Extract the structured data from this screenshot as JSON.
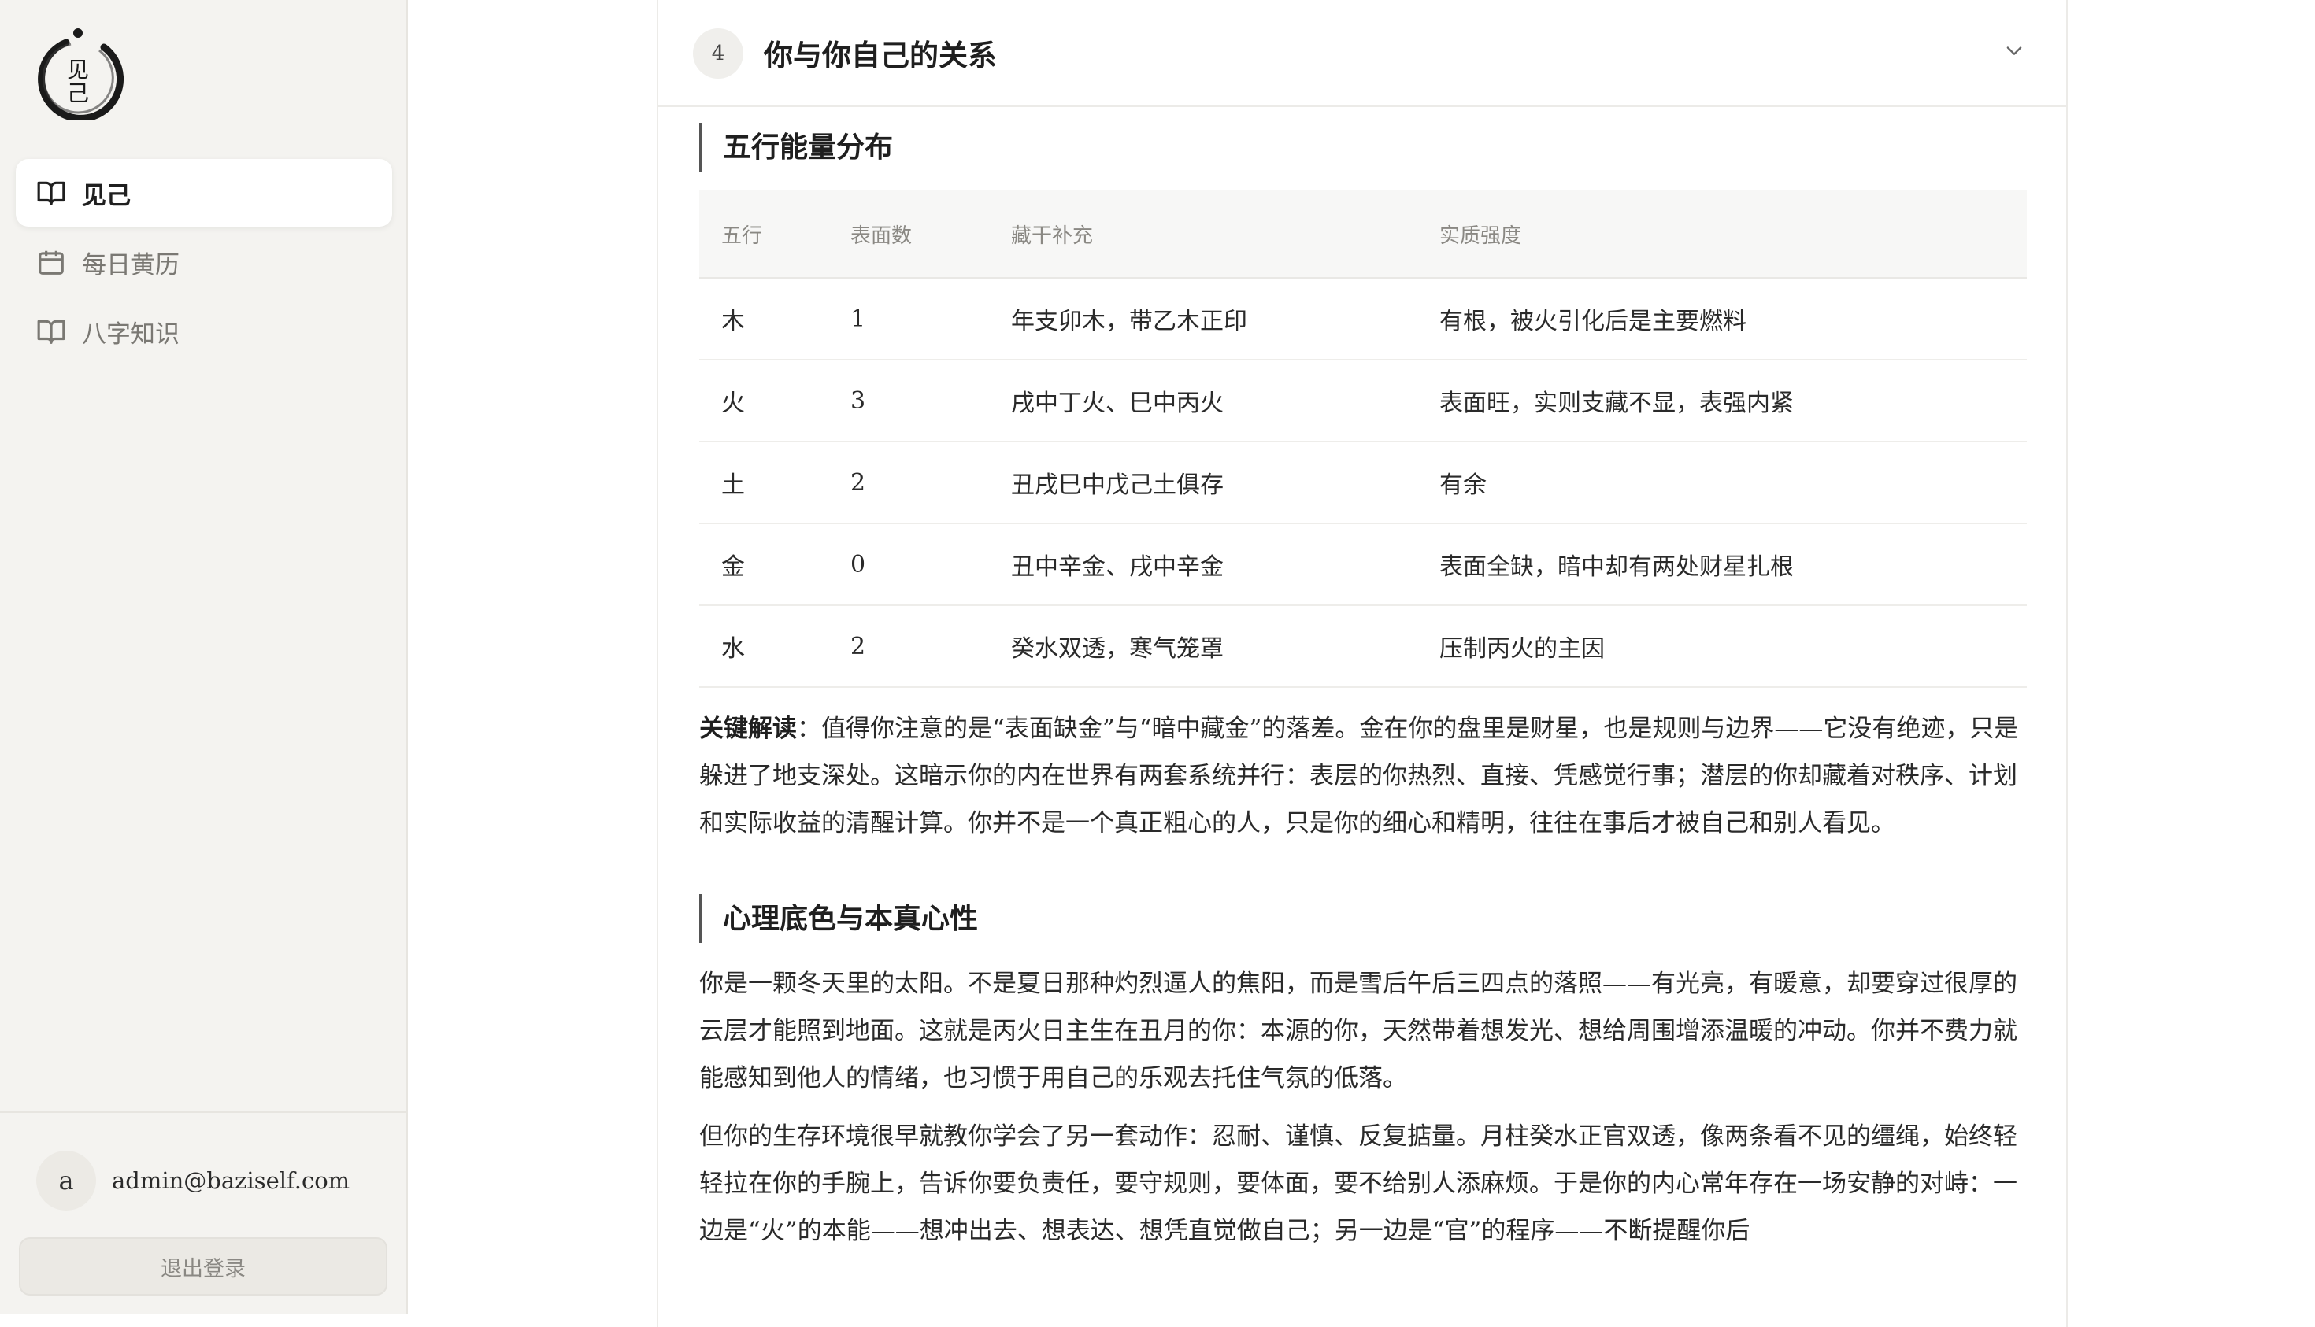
{
  "logo": {
    "glyph_top": "见",
    "glyph_bottom": "己"
  },
  "sidebar": {
    "items": [
      {
        "label": "见己",
        "icon": "book-open-icon",
        "active": true
      },
      {
        "label": "每日黄历",
        "icon": "calendar-icon",
        "active": false
      },
      {
        "label": "八字知识",
        "icon": "book-open-icon",
        "active": false
      }
    ],
    "user": {
      "avatar_letter": "a",
      "email": "admin@baziself.com"
    },
    "logout_label": "退出登录"
  },
  "section": {
    "step": "4",
    "title": "你与你自己的关系"
  },
  "wuxing": {
    "heading": "五行能量分布",
    "columns": [
      "五行",
      "表面数",
      "藏干补充",
      "实质强度"
    ],
    "rows": [
      [
        "木",
        "1",
        "年支卯木，带乙木正印",
        "有根，被火引化后是主要燃料"
      ],
      [
        "火",
        "3",
        "戌中丁火、巳中丙火",
        "表面旺，实则支藏不显，表强内紧"
      ],
      [
        "土",
        "2",
        "丑戌巳中戊己土俱存",
        "有余"
      ],
      [
        "金",
        "0",
        "丑中辛金、戌中辛金",
        "表面全缺，暗中却有两处财星扎根"
      ],
      [
        "水",
        "2",
        "癸水双透，寒气笼罩",
        "压制丙火的主因"
      ]
    ],
    "key_label": "关键解读",
    "key_text": "：值得你注意的是“表面缺金”与“暗中藏金”的落差。金在你的盘里是财星，也是规则与边界——它没有绝迹，只是躲进了地支深处。这暗示你的内在世界有两套系统并行：表层的你热烈、直接、凭感觉行事；潜层的你却藏着对秩序、计划和实际收益的清醒计算。你并不是一个真正粗心的人，只是你的细心和精明，往往在事后才被自己和别人看见。"
  },
  "psyche": {
    "heading": "心理底色与本真心性",
    "p1": "你是一颗冬天里的太阳。不是夏日那种灼烈逼人的焦阳，而是雪后午后三四点的落照——有光亮，有暖意，却要穿过很厚的云层才能照到地面。这就是丙火日主生在丑月的你：本源的你，天然带着想发光、想给周围增添温暖的冲动。你并不费力就能感知到他人的情绪，也习惯于用自己的乐观去托住气氛的低落。",
    "p2": "但你的生存环境很早就教你学会了另一套动作：忍耐、谨慎、反复掂量。月柱癸水正官双透，像两条看不见的缰绳，始终轻轻拉在你的手腕上，告诉你要负责任，要守规则，要体面，要不给别人添麻烦。于是你的内心常年存在一场安静的对峙：一边是“火”的本能——想冲出去、想表达、想凭直觉做自己；另一边是“官”的程序——不断提醒你后"
  },
  "colors": {
    "sidebar_bg": "#f4f3f0",
    "accent": "#555555",
    "text": "#2a2a2a",
    "muted": "#8a8883"
  }
}
